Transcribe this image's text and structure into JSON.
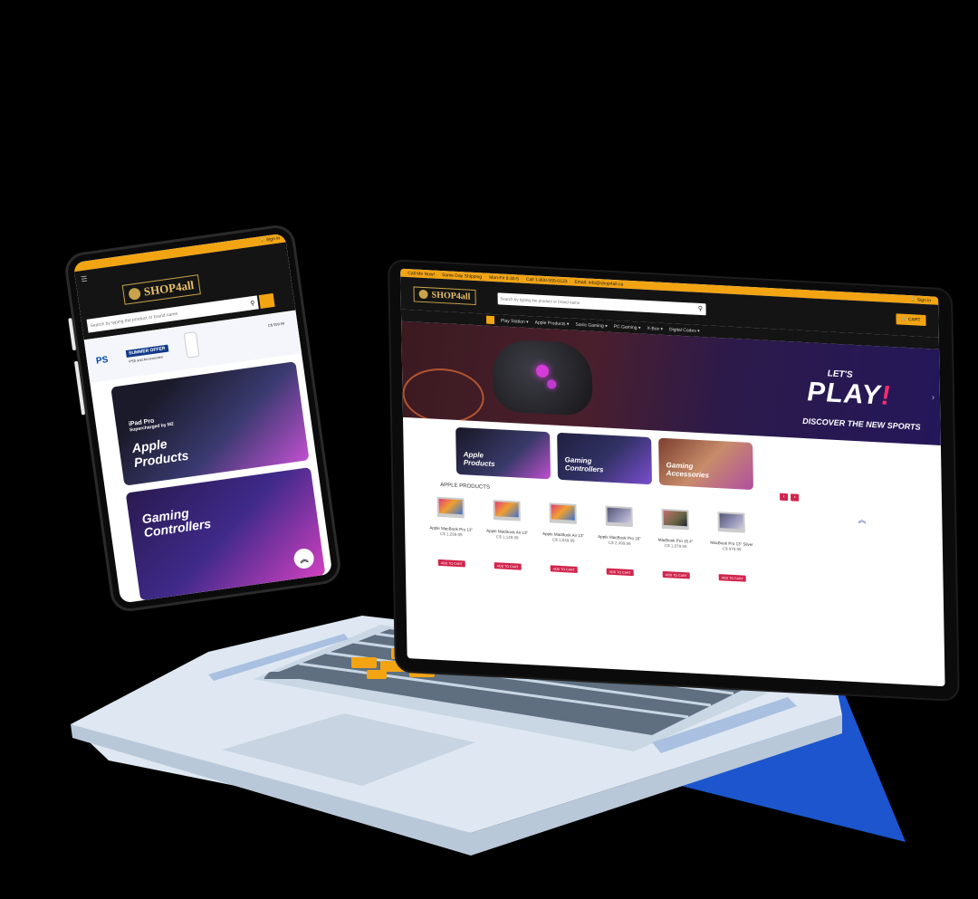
{
  "colors": {
    "accent": "#f2a413",
    "header_bg": "#141414",
    "add_btn": "#d1244c",
    "laptop_body": "#dde6f0"
  },
  "laptop": {
    "topbar": {
      "items": [
        "Call Me Now!",
        "Same Day Shipping",
        "Mon-Fri 8:30-5",
        "Call 1-800-555-0123",
        "Email: info@shop4all.ca"
      ],
      "signin": "🔒 Sign in"
    },
    "header": {
      "logo": "SHOP4all",
      "search_placeholder": "Search by typing the product or brand name",
      "search_icon": "search-icon",
      "cart_label": "🛒 CART"
    },
    "nav": [
      "Play Station ▾",
      "Apple Products ▾",
      "Sonic Gaming ▾",
      "PC Gaming ▾",
      "X-Box ▾",
      "Digital Codes ▾"
    ],
    "hero": {
      "line1": "LET'S",
      "line2": "PLAY",
      "line2_ex": "!",
      "line3": "DISCOVER THE NEW SPORTS",
      "next": "›"
    },
    "categories": [
      "Apple\nProducts",
      "Gaming\nControllers",
      "Gaming\nAccessories"
    ],
    "section_title": "APPLE PRODUCTS",
    "pager": {
      "prev": "‹",
      "next": "›"
    },
    "scroll_up": "︽",
    "products": [
      {
        "name": "Apple MacBook Pro 13\"",
        "price": "C$ 1,299.99",
        "add": "ADD TO CART"
      },
      {
        "name": "Apple MacBook Air 13\"",
        "price": "C$ 1,149.99",
        "add": "ADD TO CART"
      },
      {
        "name": "Apple MacBook Air 13\"",
        "price": "C$ 1,049.99",
        "add": "ADD TO CART"
      },
      {
        "name": "Apple MacBook Pro 16\"",
        "price": "C$ 2,499.99",
        "add": "ADD TO CART"
      },
      {
        "name": "MacBook Pro 15.4\"",
        "price": "C$ 1,679.99",
        "add": "ADD TO CART"
      },
      {
        "name": "MacBook Pro 13\" Silver",
        "price": "C$ 979.99",
        "add": "ADD TO CART"
      }
    ]
  },
  "phone": {
    "topbar": "🔒 Sign in",
    "menu_icon": "☰",
    "logo": "SHOP4all",
    "search_placeholder": "Search by typing the product or brand name",
    "promo": {
      "ps_logo": "PS",
      "badge": "SUMMER OFFER",
      "sub": "PS5 and Accessories",
      "price": "C$ 599.99"
    },
    "categories": [
      {
        "label": "Apple\nProducts",
        "sub_title": "iPad Pro",
        "sub": "Supercharged by M2"
      },
      {
        "label": "Gaming\nControllers"
      }
    ],
    "scroll_up": "︽"
  }
}
